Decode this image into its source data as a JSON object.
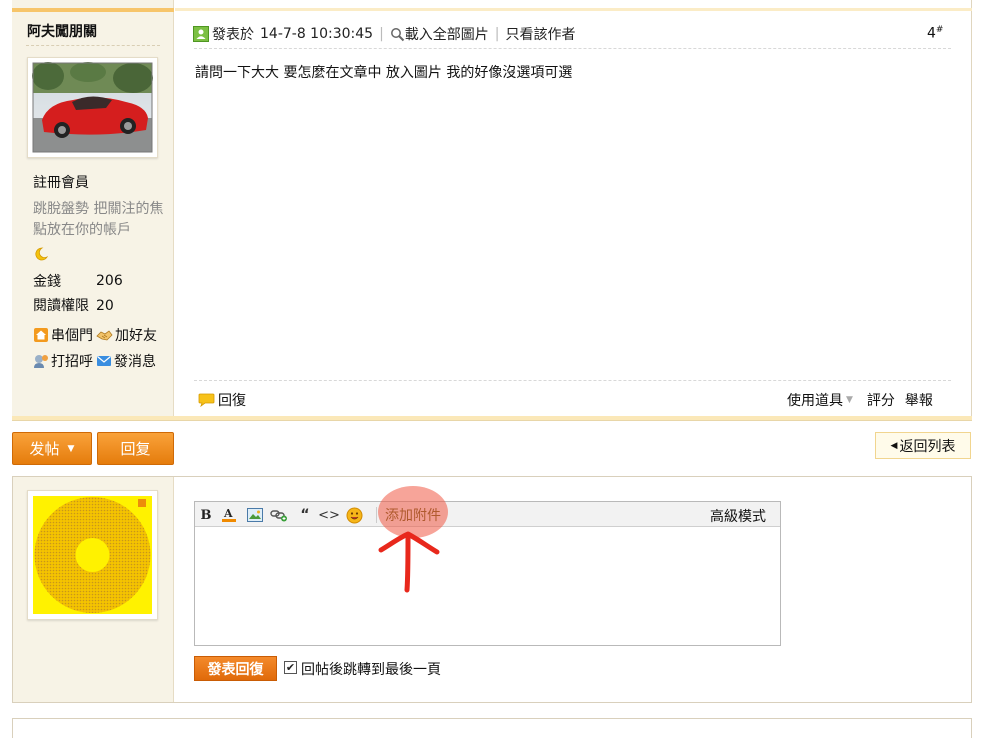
{
  "author": {
    "name": "阿夫闖朋關",
    "group": "註冊會員",
    "signature": "跳脫盤勢 把關注的焦點放在你的帳戶",
    "money_label": "金錢",
    "money_value": "206",
    "read_label": "閱讀權限",
    "read_value": "20",
    "actions": {
      "home": "串個門",
      "add_friend": "加好友",
      "poke": "打招呼",
      "message": "發消息"
    }
  },
  "post": {
    "posted_label": "發表於",
    "timestamp": "14-7-8 10:30:45",
    "load_images": "載入全部圖片",
    "only_author": "只看該作者",
    "floor": "4",
    "floor_mark": "#",
    "body": "請問一下大大 要怎麼在文章中 放入圖片 我的好像沒選項可選",
    "reply_link": "回復",
    "tools": "使用道具",
    "rate": "評分",
    "report": "舉報"
  },
  "action_bar": {
    "new_post": "发帖",
    "reply": "回复",
    "back_to_list": "返回列表"
  },
  "editor": {
    "toolbar": {
      "bold": "B",
      "text_color_glyph": "A",
      "quote": "“",
      "code": "<>"
    },
    "attach_label": "添加附件",
    "advanced_mode": "高級模式",
    "content": ""
  },
  "quick_reply": {
    "submit": "發表回復",
    "jump_checked": true,
    "jump_label": "回帖後跳轉到最後一頁"
  },
  "colors": {
    "accent_orange": "#e57c0c",
    "sidebar_bg": "#f7f3e6",
    "highlight": "#f05a46",
    "arrow_red": "#e8281c"
  }
}
